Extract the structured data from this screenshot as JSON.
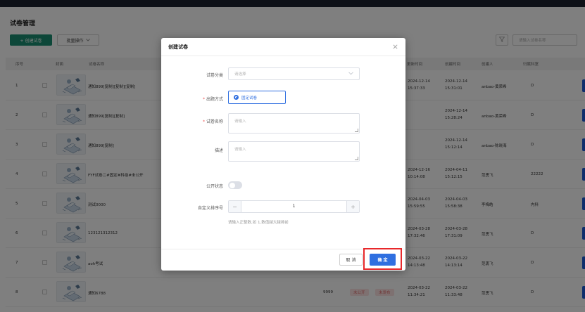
{
  "page": {
    "title": "试卷管理",
    "create_button": "+ 创建试卷",
    "batch_button": "批量操作",
    "search_placeholder": "请输入试卷名称",
    "columns": [
      "序号",
      "封面",
      "试卷名称",
      "更新时间",
      "创建时间",
      "创建人",
      "归属科室"
    ],
    "rows": [
      {
        "no": "1",
        "name": "通知899[复制][复制][复制]",
        "updated": "2024-12-14",
        "updated_time": "15:37:33",
        "created": "2024-12-14",
        "created_time": "15:31:01",
        "creator": "anbao-黄荣希",
        "dept": "D"
      },
      {
        "no": "2",
        "name": "通知899[复制][复制]",
        "updated": "",
        "updated_time": "",
        "created": "2024-12-14",
        "created_time": "15:28:24",
        "creator": "anbao-黄荣希",
        "dept": "D"
      },
      {
        "no": "3",
        "name": "通知899[复制]",
        "updated": "",
        "updated_time": "",
        "created": "2024-12-14",
        "created_time": "15:12:14",
        "creator": "anbao-陈晓海",
        "dept": "D"
      },
      {
        "no": "4",
        "name": "FYF试卷二#固定#科级#未公开",
        "updated": "2024-12-16",
        "updated_time": "10:14:08",
        "created": "2024-04-11",
        "created_time": "15:12:15",
        "creator": "范勇飞",
        "dept": "22222"
      },
      {
        "no": "5",
        "name": "测试0000",
        "updated": "2024-04-03",
        "updated_time": "15:59:55",
        "created": "2024-04-03",
        "created_time": "15:58:38",
        "creator": "李梅皓",
        "dept": "内科"
      },
      {
        "no": "6",
        "name": "123121312312",
        "updated": "2024-03-28",
        "updated_time": "17:32:46",
        "created": "2024-03-28",
        "created_time": "17:31:09",
        "creator": "范勇飞",
        "dept": "D"
      },
      {
        "no": "7",
        "name": "aoh考试",
        "updated": "2024-03-22",
        "updated_time": "14:13:48",
        "created": "2024-03-22",
        "created_time": "14:13:14",
        "creator": "范勇飞",
        "dept": "D"
      },
      {
        "no": "8",
        "name": "通知6788",
        "score": "9999",
        "status1": "未公开",
        "status2": "未发布",
        "updated": "2024-03-22",
        "updated_time": "11:34:21",
        "created": "2024-03-22",
        "created_time": "11:33:48",
        "creator": "范勇飞",
        "dept": "D"
      }
    ]
  },
  "dialog": {
    "title": "创建试卷",
    "category_label": "试卷分类",
    "category_placeholder": "请选择",
    "mode_label": "出题方式",
    "mode_value": "固定试卷",
    "name_label": "试卷名称",
    "name_placeholder": "请输入",
    "desc_label": "描述",
    "desc_placeholder": "请输入",
    "public_label": "公开状态",
    "sort_label": "自定义排序号",
    "sort_value": "1",
    "sort_minus": "−",
    "sort_plus": "+",
    "sort_hint": "请输入正整数,如 1,数值越大越排前",
    "cancel": "取 消",
    "ok": "确 定"
  }
}
